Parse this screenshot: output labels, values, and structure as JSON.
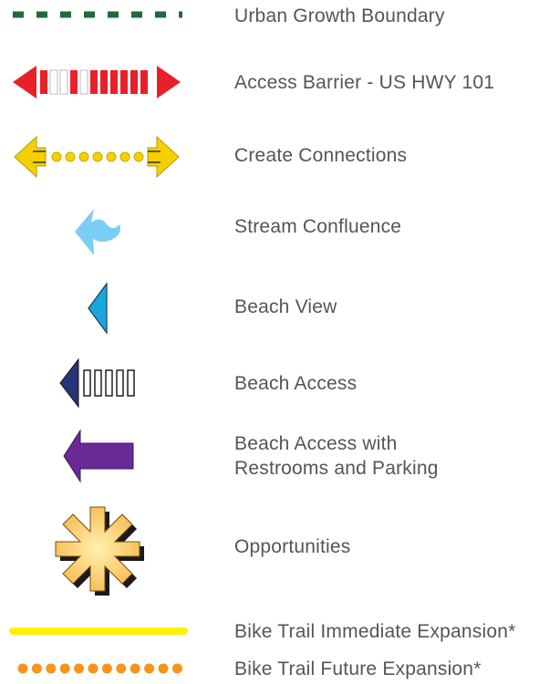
{
  "legend": {
    "items": [
      {
        "id": "urban-growth-boundary",
        "label": "Urban Growth Boundary",
        "symbol": "dashed-line-icon",
        "color": "#1f6b3a"
      },
      {
        "id": "access-barrier",
        "label": "Access Barrier - US HWY 101",
        "symbol": "double-arrow-barrier-icon",
        "color": "#e8202a"
      },
      {
        "id": "create-connections",
        "label": "Create Connections",
        "symbol": "double-arrow-dots-icon",
        "color": "#f5d000"
      },
      {
        "id": "stream-confluence",
        "label": "Stream Confluence",
        "symbol": "stream-arrow-icon",
        "color": "#7ccdf4"
      },
      {
        "id": "beach-view",
        "label": "Beach View",
        "symbol": "triangle-pointer-icon",
        "color": "#1aa6e0"
      },
      {
        "id": "beach-access",
        "label": "Beach Access",
        "symbol": "arrow-with-bars-icon",
        "color": "#2a3478"
      },
      {
        "id": "beach-access-restrooms",
        "label": "Beach Access with\nRestrooms and Parking",
        "symbol": "left-arrow-icon",
        "color": "#6a2a96"
      },
      {
        "id": "opportunities",
        "label": "Opportunities",
        "symbol": "asterisk-burst-icon",
        "color": "#f7b64a"
      },
      {
        "id": "bike-trail-immediate",
        "label": "Bike Trail Immediate Expansion*",
        "symbol": "solid-line-icon",
        "color": "#fff200"
      },
      {
        "id": "bike-trail-future",
        "label": "Bike Trail Future Expansion*",
        "symbol": "dotted-line-icon",
        "color": "#f7941d"
      }
    ]
  }
}
